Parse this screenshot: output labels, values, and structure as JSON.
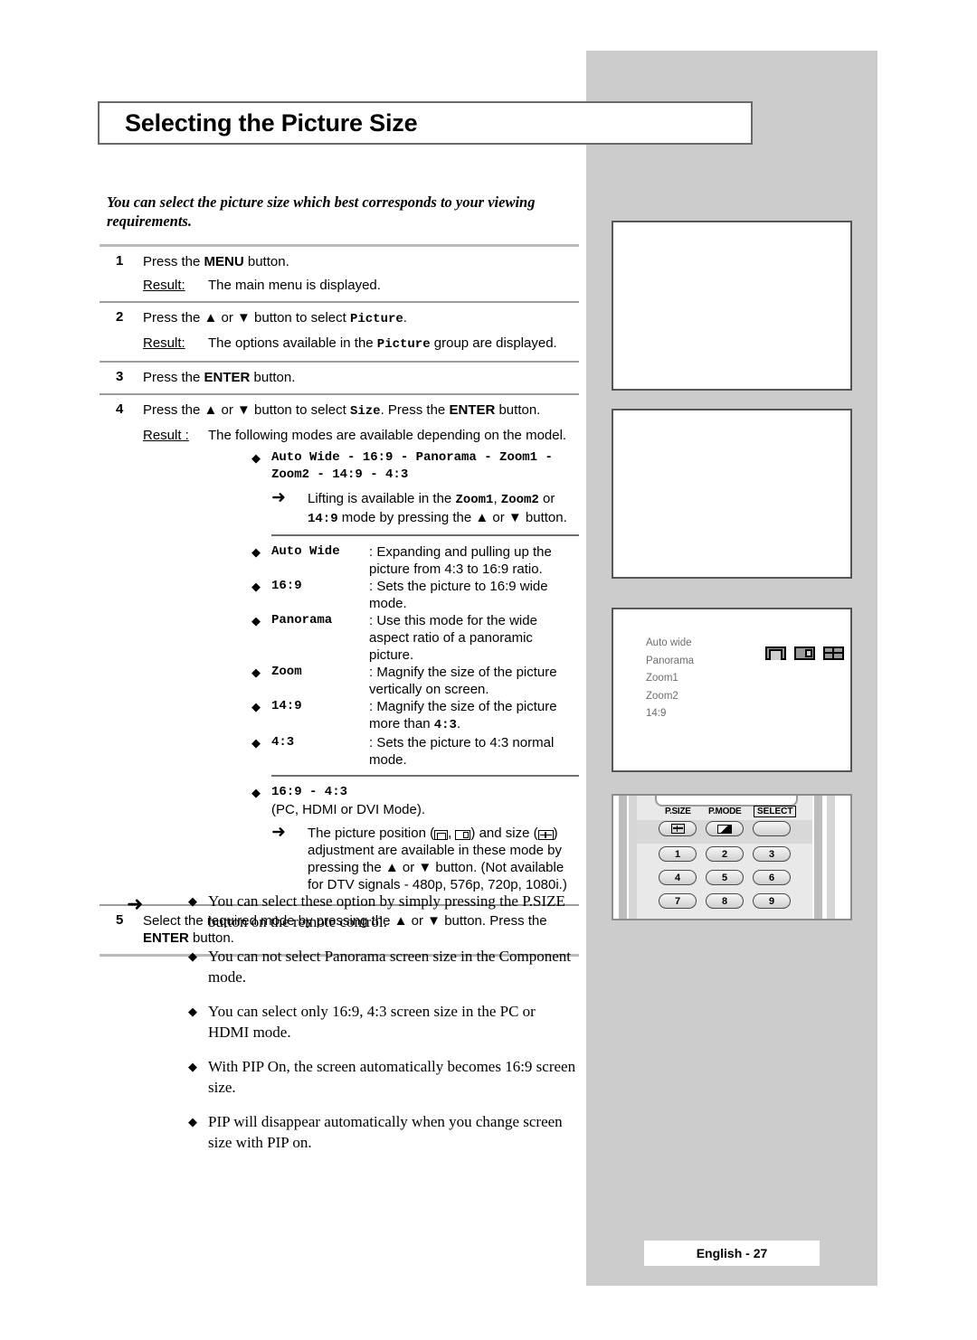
{
  "page": {
    "title": "Selecting the Picture Size",
    "intro": "You can select the picture size which best corresponds to your viewing requirements.",
    "footer": "English - 27",
    "accent_grey": "#cccccc",
    "rule_grey": "#9d9d9d"
  },
  "steps": [
    {
      "num": "1",
      "instruction_pre": "Press the ",
      "instruction_key": "MENU",
      "instruction_post": " button.",
      "result_label": "Result:",
      "result_text": "The main menu is displayed."
    },
    {
      "num": "2",
      "instruction_pre": "Press the ▲ or ▼ button to select ",
      "instruction_key": "Picture",
      "instruction_post": ".",
      "result_label": "Result:",
      "result_pre": "The options available in the ",
      "result_key": "Picture",
      "result_post": " group are displayed."
    },
    {
      "num": "3",
      "instruction_pre": "Press the ",
      "instruction_key": "ENTER",
      "instruction_post": " button."
    },
    {
      "num": "4",
      "instruction_pre": "Press the ▲ or ▼ button to select ",
      "instruction_key": "Size",
      "instruction_mid": ". Press the ",
      "instruction_key2": "ENTER",
      "instruction_post": " button.",
      "result_label": "Result :",
      "result_text": "The following modes are available depending on the model."
    },
    {
      "num": "5",
      "instruction_full_pre": "Select the required mode by pressing the ▲ or ▼ button. Press the ",
      "instruction_key": "ENTER",
      "instruction_post": " button."
    }
  ],
  "modes": {
    "bullet": "◆",
    "arrow": "➜",
    "sequence_line1": "Auto Wide - 16:9 - Panorama - Zoom1 -",
    "sequence_line2": "Zoom2 - 14:9 - 4:3",
    "lifting_pre": "Lifting is available in the ",
    "lifting_k1": "Zoom1",
    "lifting_sep": ", ",
    "lifting_k2": "Zoom2",
    "lifting_mid": " or ",
    "lifting_k3": "14:9",
    "lifting_post": " mode by pressing the ▲ or ▼ button.",
    "definitions": [
      {
        "name": "Auto Wide",
        "desc": ": Expanding and pulling up the picture from 4:3 to 16:9 ratio."
      },
      {
        "name": "16:9",
        "desc": ": Sets the picture to 16:9 wide mode."
      },
      {
        "name": "Panorama",
        "desc": ": Use this mode for the wide aspect ratio of a panoramic picture."
      },
      {
        "name": "Zoom",
        "desc": ": Magnify the size of the picture vertically on  screen."
      },
      {
        "name": "14:9",
        "desc_pre": ": Magnify the size of the picture more than ",
        "desc_key": "4:3",
        "desc_post": "."
      },
      {
        "name": "4:3",
        "desc": ": Sets the picture to 4:3 normal mode."
      }
    ],
    "pc_heading": "16:9 - 4:3",
    "pc_subheading": "(PC, HDMI or DVI Mode).",
    "pc_note_pre": "The picture position (",
    "pc_note_mid": ") and size (",
    "pc_note_post": ") adjustment are available in these mode by pressing the ▲ or ▼ button. (Not available for DTV signals - 480p, 576p, 720p, 1080i.)"
  },
  "notes": {
    "arrow": "➜",
    "bullet": "◆",
    "items": [
      "You can select these option by simply pressing the P.SIZE button on the remote control.",
      "You can not select Panorama screen size in the Component mode.",
      "You can select only 16:9, 4:3 screen size in the PC or HDMI mode.",
      "With PIP On, the screen automatically becomes 16:9 screen size.",
      "PIP will disappear automatically when you change screen size with PIP on."
    ]
  },
  "osd": {
    "items": [
      "Auto wide",
      "Panorama",
      "Zoom1",
      "Zoom2",
      "14:9"
    ],
    "icon_names": [
      "picture-position-vertical-icon",
      "picture-position-horizontal-icon",
      "picture-size-icon"
    ]
  },
  "remote": {
    "labels": {
      "psize": "P.SIZE",
      "pmode": "P.MODE",
      "select": "SELECT"
    },
    "numbers": [
      "1",
      "2",
      "3",
      "4",
      "5",
      "6",
      "7",
      "8",
      "9"
    ]
  }
}
